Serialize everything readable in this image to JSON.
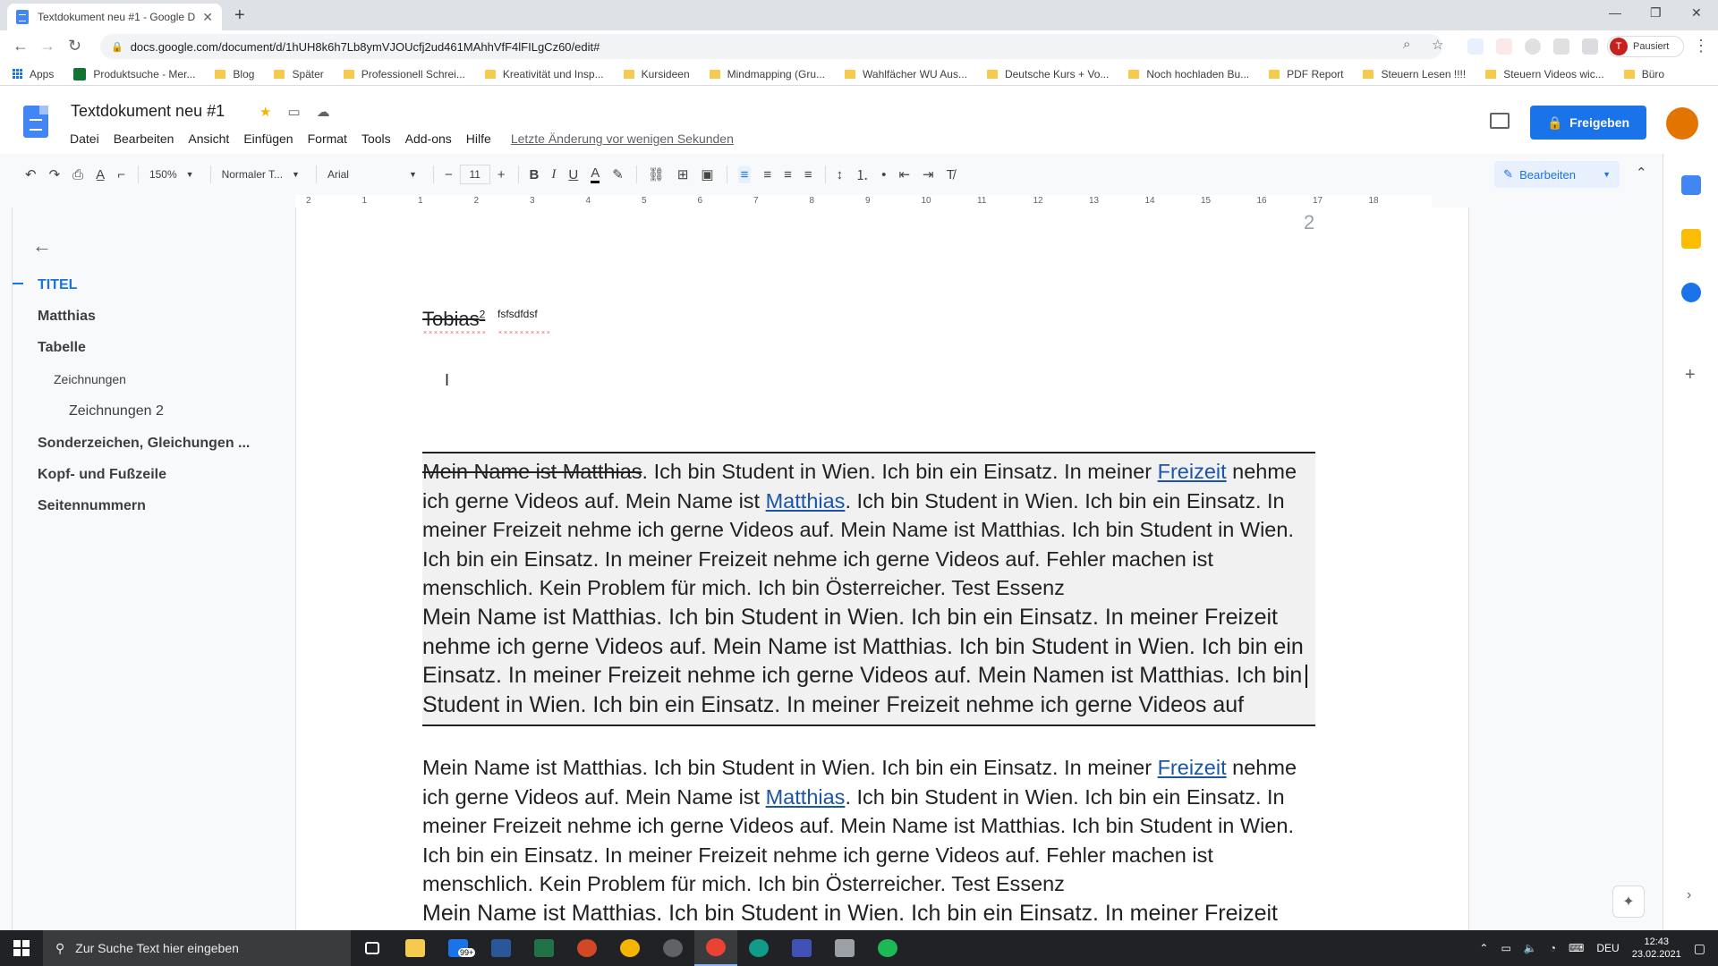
{
  "browser": {
    "tab_title": "Textdokument neu #1 - Google D",
    "url": "docs.google.com/document/d/1hUH8k6h7Lb8ymVJOUcfj2ud461MAhhVfF4lFILgCz60/edit#",
    "profile_status": "Pausiert",
    "profile_initial": "T",
    "bookmarks": [
      "Apps",
      "Produktsuche - Mer...",
      "Blog",
      "Später",
      "Professionell Schrei...",
      "Kreativität und Insp...",
      "Kursideen",
      "Mindmapping (Gru...",
      "Wahlfächer WU Aus...",
      "Deutsche Kurs + Vo...",
      "Noch hochladen Bu...",
      "PDF Report",
      "Steuern Lesen !!!!",
      "Steuern Videos wic...",
      "Büro"
    ]
  },
  "docs": {
    "title": "Textdokument neu #1",
    "menu": [
      "Datei",
      "Bearbeiten",
      "Ansicht",
      "Einfügen",
      "Format",
      "Tools",
      "Add-ons",
      "Hilfe"
    ],
    "last_edit": "Letzte Änderung vor wenigen Sekunden",
    "share_label": "Freigeben",
    "toolbar": {
      "zoom": "150%",
      "style": "Normaler T...",
      "font": "Arial",
      "font_size": "11",
      "mode": "Bearbeiten"
    },
    "ruler_numbers": [
      "2",
      "1",
      "1",
      "2",
      "3",
      "4",
      "5",
      "6",
      "7",
      "8",
      "9",
      "10",
      "11",
      "12",
      "13",
      "14",
      "15",
      "16",
      "17",
      "18"
    ]
  },
  "outline": {
    "items": [
      {
        "label": "TITEL",
        "level": "title"
      },
      {
        "label": "Matthias",
        "level": "h1"
      },
      {
        "label": "Tabelle",
        "level": "h1"
      },
      {
        "label": "Zeichnungen",
        "level": "h2"
      },
      {
        "label": "Zeichnungen 2",
        "level": "h3"
      },
      {
        "label": "Sonderzeichen, Gleichungen ...",
        "level": "h1"
      },
      {
        "label": "Kopf- und Fußzeile",
        "level": "h1"
      },
      {
        "label": "Seitennummern",
        "level": "h1"
      }
    ]
  },
  "page": {
    "number": "2",
    "heading_word": "Tobias",
    "heading_sup": "2",
    "sup_text": "fsfsdfdsf",
    "box": {
      "strike": "Mein Name ist Matthias",
      "p1_a": ". Ich bin Student in Wien. Ich bin ein Einsatz. In meiner ",
      "link1": "Freizeit",
      "p1_b": " nehme ich gerne Videos auf. Mein Name ist ",
      "link2": "Matthias",
      "p1_c": ". Ich bin Student in Wien. Ich bin ein Einsatz. In meiner Freizeit nehme ich gerne Videos auf. Mein Name ist Matthias. Ich bin Student in Wien. Ich bin ein Einsatz. In meiner Freizeit nehme ich gerne Videos auf. Fehler machen ist menschlich. Kein Problem für mich. Ich bin Österreicher. Test Essenz",
      "p2": "Mein Name ist Matthias. Ich bin Student in Wien. Ich bin ein Einsatz. In meiner Freizeit nehme ich gerne Videos auf. Mein Name ist Matthias. Ich bin Student in Wien. Ich bin ein Einsatz. In meiner Freizeit nehme ich gerne Videos auf. Mein Namen ist Matthias. Ich bin",
      "p2_end": "Student in Wien. Ich bin ein Einsatz. In meiner Freizeit nehme ich gerne Videos auf"
    },
    "below": {
      "p1_a": "Mein Name ist Matthias. Ich bin Student in Wien. Ich bin ein Einsatz. In meiner ",
      "link1": "Freizeit",
      "p1_b": " nehme ich gerne Videos auf. Mein Name ist ",
      "link2": "Matthias",
      "p1_c": ". Ich bin Student in Wien. Ich bin ein Einsatz. In meiner Freizeit nehme ich gerne Videos auf. Mein Name ist Matthias. Ich bin Student in Wien. Ich bin ein Einsatz. In meiner Freizeit nehme ich gerne Videos auf. Fehler machen ist menschlich. Kein Problem für mich. Ich bin Österreicher. Test Essenz",
      "p2": "Mein Name ist Matthias. Ich bin Student in Wien. Ich bin ein Einsatz. In meiner Freizeit"
    }
  },
  "taskbar": {
    "search_placeholder": "Zur Suche Text hier eingeben",
    "mail_badge": "99+",
    "lang": "DEU",
    "time": "12:43",
    "date": "23.02.2021"
  },
  "colors": {
    "accent": "#1a73e8",
    "link": "#1a55a8"
  }
}
